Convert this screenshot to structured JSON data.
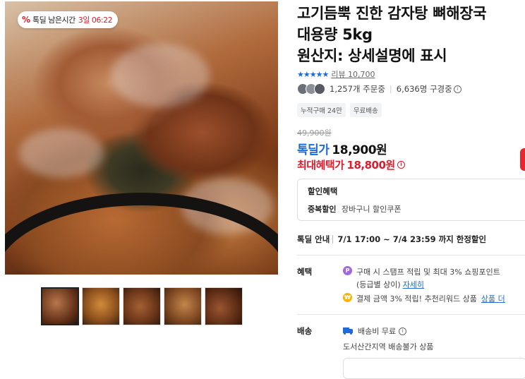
{
  "badge": {
    "prefix": "%",
    "label": "톡딜 남은시간",
    "time": "3일 06:22"
  },
  "product": {
    "title_lines": [
      "고기듬뿍 진한 감자탕 뼈해장국",
      "대용량 5kg",
      "원산지: 상세설명에 표시"
    ],
    "rating_stars": "★★★★★",
    "review_text": "리뷰 10,700",
    "orders": "1,257개 주문중",
    "watchers": "6,636명 구경중",
    "tags": [
      "누적구매 24만",
      "무료배송"
    ],
    "original_price": "49,900원",
    "deal_label": "톡딜가",
    "deal_price": "18,900원",
    "max_label": "최대혜택가",
    "max_price": "18,800원"
  },
  "discount": {
    "heading": "할인혜택",
    "row_label": "중복할인",
    "row_value": "장바구니 할인쿠폰"
  },
  "deal_info": {
    "label": "톡딜 안내",
    "value": "7/1 17:00 ~ 7/4 23:59 까지 한정할인"
  },
  "benefit": {
    "label": "혜택",
    "row1_line1": "구매 시 스탬프 적립 및 최대 3% 쇼핑포인트",
    "row1_line2": "(등급별 상이)",
    "row1_link": "자세히",
    "row2_text": "결제 금액 3% 적립! 추천리워드 상품",
    "row2_link": "상품 더"
  },
  "shipping": {
    "label": "배송",
    "fee": "배송비 무료",
    "note": "도서산간지역 배송불가 상품"
  },
  "colors": {
    "deal_blue": "#1d6ad8",
    "max_red": "#e21b2b"
  }
}
